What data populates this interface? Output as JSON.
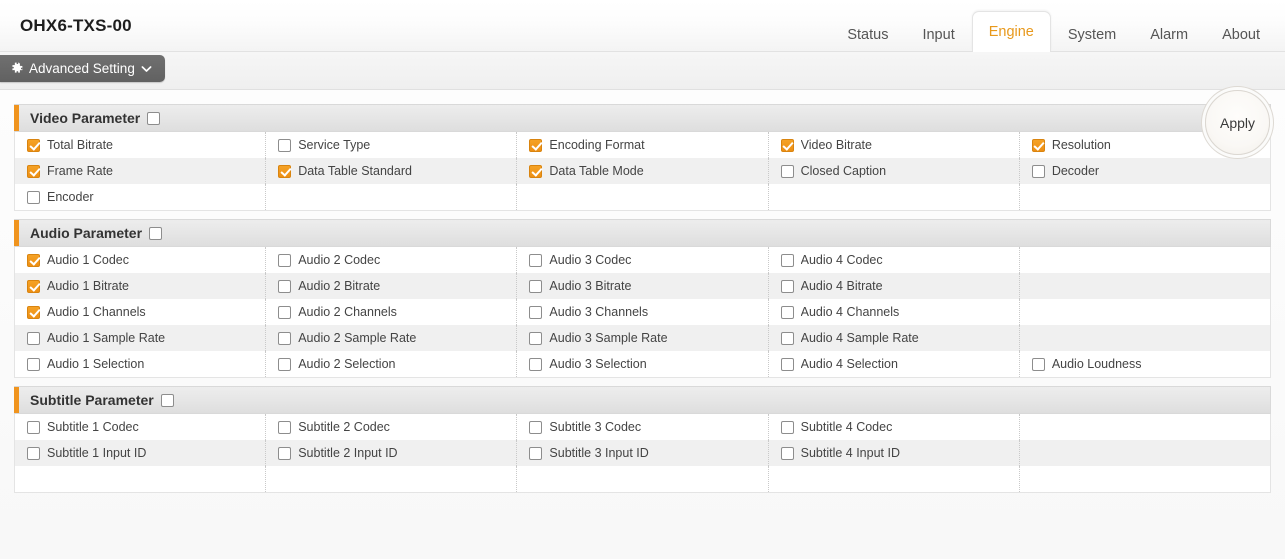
{
  "header": {
    "title": "OHX6-TXS-00",
    "tabs": [
      {
        "label": "Status",
        "active": false
      },
      {
        "label": "Input",
        "active": false
      },
      {
        "label": "Engine",
        "active": true
      },
      {
        "label": "System",
        "active": false
      },
      {
        "label": "Alarm",
        "active": false
      },
      {
        "label": "About",
        "active": false
      }
    ]
  },
  "toolbar": {
    "advanced_setting_label": "Advanced Setting",
    "gear_icon": "gear-icon",
    "chevron_icon": "chevron-down-icon"
  },
  "apply": {
    "label": "Apply"
  },
  "colors": {
    "accent": "#f0941e",
    "active_tab_text": "#e8991c",
    "checkbox_checked": "#ed8f14",
    "row_alt": "#f0f0f0"
  },
  "sections": [
    {
      "title": "Video Parameter",
      "checked": false,
      "rows": [
        [
          {
            "label": "Total Bitrate",
            "checked": true
          },
          {
            "label": "Service Type",
            "checked": false
          },
          {
            "label": "Encoding Format",
            "checked": true
          },
          {
            "label": "Video Bitrate",
            "checked": true
          },
          {
            "label": "Resolution",
            "checked": true
          }
        ],
        [
          {
            "label": "Frame Rate",
            "checked": true
          },
          {
            "label": "Data Table Standard",
            "checked": true
          },
          {
            "label": "Data Table Mode",
            "checked": true
          },
          {
            "label": "Closed Caption",
            "checked": false
          },
          {
            "label": "Decoder",
            "checked": false
          }
        ],
        [
          {
            "label": "Encoder",
            "checked": false
          },
          {
            "label": "",
            "checked": null
          },
          {
            "label": "",
            "checked": null
          },
          {
            "label": "",
            "checked": null
          },
          {
            "label": "",
            "checked": null
          }
        ]
      ]
    },
    {
      "title": "Audio Parameter",
      "checked": false,
      "rows": [
        [
          {
            "label": "Audio 1 Codec",
            "checked": true
          },
          {
            "label": "Audio 2 Codec",
            "checked": false
          },
          {
            "label": "Audio 3 Codec",
            "checked": false
          },
          {
            "label": "Audio 4 Codec",
            "checked": false
          },
          {
            "label": "",
            "checked": null
          }
        ],
        [
          {
            "label": "Audio 1 Bitrate",
            "checked": true
          },
          {
            "label": "Audio 2 Bitrate",
            "checked": false
          },
          {
            "label": "Audio 3 Bitrate",
            "checked": false
          },
          {
            "label": "Audio 4 Bitrate",
            "checked": false
          },
          {
            "label": "",
            "checked": null
          }
        ],
        [
          {
            "label": "Audio 1 Channels",
            "checked": true
          },
          {
            "label": "Audio 2 Channels",
            "checked": false
          },
          {
            "label": "Audio 3 Channels",
            "checked": false
          },
          {
            "label": "Audio 4 Channels",
            "checked": false
          },
          {
            "label": "",
            "checked": null
          }
        ],
        [
          {
            "label": "Audio 1 Sample Rate",
            "checked": false
          },
          {
            "label": "Audio 2 Sample Rate",
            "checked": false
          },
          {
            "label": "Audio 3 Sample Rate",
            "checked": false
          },
          {
            "label": "Audio 4 Sample Rate",
            "checked": false
          },
          {
            "label": "",
            "checked": null
          }
        ],
        [
          {
            "label": "Audio 1 Selection",
            "checked": false
          },
          {
            "label": "Audio 2 Selection",
            "checked": false
          },
          {
            "label": "Audio 3 Selection",
            "checked": false
          },
          {
            "label": "Audio 4 Selection",
            "checked": false
          },
          {
            "label": "Audio Loudness",
            "checked": false
          }
        ]
      ]
    },
    {
      "title": "Subtitle Parameter",
      "checked": false,
      "rows": [
        [
          {
            "label": "Subtitle 1 Codec",
            "checked": false
          },
          {
            "label": "Subtitle 2 Codec",
            "checked": false
          },
          {
            "label": "Subtitle 3 Codec",
            "checked": false
          },
          {
            "label": "Subtitle 4 Codec",
            "checked": false
          },
          {
            "label": "",
            "checked": null
          }
        ],
        [
          {
            "label": "Subtitle 1 Input ID",
            "checked": false
          },
          {
            "label": "Subtitle 2 Input ID",
            "checked": false
          },
          {
            "label": "Subtitle 3 Input ID",
            "checked": false
          },
          {
            "label": "Subtitle 4 Input ID",
            "checked": false
          },
          {
            "label": "",
            "checked": null
          }
        ],
        [
          {
            "label": "",
            "checked": null
          },
          {
            "label": "",
            "checked": null
          },
          {
            "label": "",
            "checked": null
          },
          {
            "label": "",
            "checked": null
          },
          {
            "label": "",
            "checked": null
          }
        ]
      ]
    }
  ]
}
